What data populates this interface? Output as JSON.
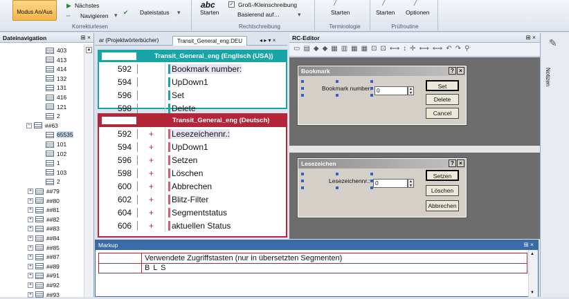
{
  "ribbon": {
    "modus_label": "Modus An/Aus",
    "next_label": "Nächstes",
    "navigate_label": "Navigieren",
    "filestatus_label": "Dateistatus",
    "group_korrektur": "Korrekturlesen",
    "start1": "Starten",
    "case_label": "Groß-/Kleinschreibung",
    "based_label": "Basierend auf…",
    "group_recht": "Rechtschreibung",
    "start2": "Starten",
    "group_term": "Terminologie",
    "start3": "Starten",
    "options": "Optionen",
    "group_pruef": "Prüfroutine"
  },
  "nav": {
    "title": "Dateinavigation",
    "pin": "⊞ ×",
    "items": [
      "403",
      "413",
      "414",
      "132",
      "131",
      "416",
      "121",
      "2",
      "##63",
      "65535",
      "101",
      "102",
      "1",
      "103",
      "2",
      "##79",
      "##80",
      "##81",
      "##82",
      "##83",
      "##84",
      "##85",
      "##87",
      "##89",
      "##91",
      "##92",
      "##93"
    ]
  },
  "doctabs": {
    "tab1": "ar (Projektwörterbücher)",
    "tab2": "Transit_General_eng.DEU",
    "ctrl": "◂ ▸ ▾ ×"
  },
  "grid_en": {
    "title": "Transit_General_eng (Englisch (USA))",
    "rows": [
      {
        "num": "592",
        "text": "Bookmark number:"
      },
      {
        "num": "594",
        "text": "UpDown1"
      },
      {
        "num": "596",
        "text": "Set"
      },
      {
        "num": "598",
        "text": "Delete"
      }
    ]
  },
  "grid_de": {
    "title": "Transit_General_eng (Deutsch)",
    "rows": [
      {
        "num": "592",
        "st": "+",
        "text": "Lesezeichennr.:"
      },
      {
        "num": "594",
        "st": "+",
        "text": "UpDown1"
      },
      {
        "num": "596",
        "st": "+",
        "text": "Setzen"
      },
      {
        "num": "598",
        "st": "+",
        "text": "Löschen"
      },
      {
        "num": "600",
        "st": "+",
        "text": "Abbrechen"
      },
      {
        "num": "602",
        "st": "+",
        "text": "Blitz-Filter"
      },
      {
        "num": "604",
        "st": "+",
        "text": "Segmentstatus"
      },
      {
        "num": "606",
        "st": "+",
        "text": "aktuellen Status"
      }
    ]
  },
  "rc": {
    "title": "RC-Editor",
    "pin": "⊞ ×",
    "dlg1": {
      "title": "Bookmark",
      "help": "?",
      "close": "×",
      "label": "Bookmark number:",
      "value": "0",
      "btn_set": "Set",
      "btn_delete": "Delete",
      "btn_cancel": "Cancel"
    },
    "dlg2": {
      "title": "Lesezeichen",
      "help": "?",
      "close": "×",
      "label": "Lesezeichennr.:",
      "value": "0",
      "btn_set": "Setzen",
      "btn_delete": "Löschen",
      "btn_cancel": "Abbrechen"
    }
  },
  "markup": {
    "title": "Markup",
    "pin": "⊞ ×",
    "row1": "Verwendete Zugriffstasten (nur in übersetzten Segmenten)",
    "row2": "B L S"
  },
  "side": {
    "notes": "Notizen"
  },
  "colors": {
    "en": "#17a5a5",
    "de": "#b3263a",
    "rc_bg": "#6d6d6d"
  }
}
